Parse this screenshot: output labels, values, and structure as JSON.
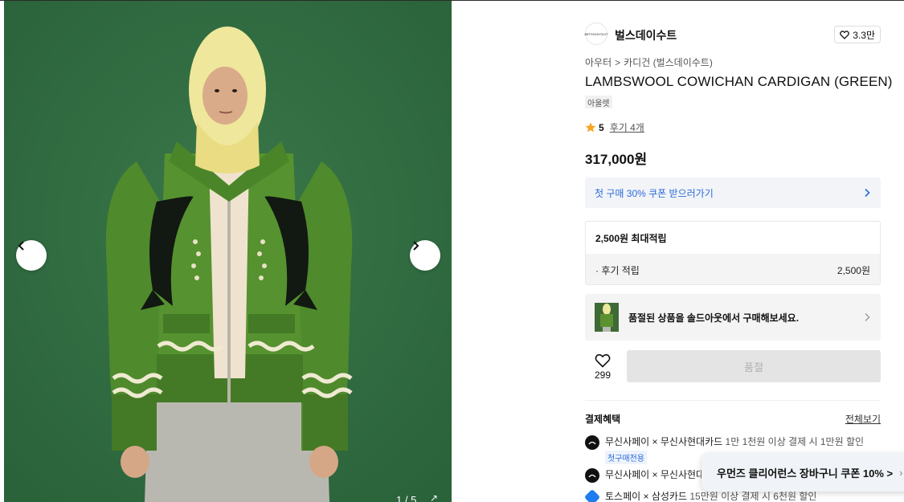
{
  "gallery": {
    "counter": "1 / 5",
    "prev_label": "‹",
    "next_label": "›",
    "expand_label": "↗"
  },
  "brand": {
    "name": "벌스데이수트",
    "logo_text": "BIRTHDAYSUIT",
    "likes": "3.3만"
  },
  "breadcrumb": {
    "level1": "아우터",
    "separator": ">",
    "level2": "카디건 (벌스데이수트)"
  },
  "product": {
    "title": "LAMBSWOOL COWICHAN CARDIGAN (GREEN)",
    "tag": "아울렛",
    "rating": "5",
    "reviews": "후기 4개",
    "price": "317,000원"
  },
  "coupon": {
    "label": "첫 구매 30% 쿠폰 받으러가기",
    "chevron": "›"
  },
  "points": {
    "head": "2,500원 최대적립",
    "row_label": "· 후기 적립",
    "row_value": "2,500원"
  },
  "soldout": {
    "text": "품절된 상품을 솔드아웃에서 구매해보세요.",
    "chevron": "›"
  },
  "actions": {
    "wish_count": "299",
    "buy_label": "품절"
  },
  "benefits": {
    "head": "결제혜택",
    "all": "전체보기",
    "items": [
      {
        "name": "무신사페이 × 무신사현대카드",
        "desc": "1만 1천원 이상 결제 시 1만원 할인",
        "badge": "첫구매전용"
      },
      {
        "name": "무신사페이 × 무신사현대",
        "desc": ""
      },
      {
        "name": "토스페이 × 삼성카드",
        "desc": "15만원 이상 결제 시 6천원 할인"
      }
    ]
  },
  "floating": {
    "label": "우먼즈 클리어런스 장바구니 쿠폰 10% >",
    "chevron": "›"
  },
  "colors": {
    "gallery_bg": "#2f6a3f",
    "sweater": "#4f8a2c",
    "accent_blue": "#2a6bd8",
    "star": "#f5a623"
  }
}
